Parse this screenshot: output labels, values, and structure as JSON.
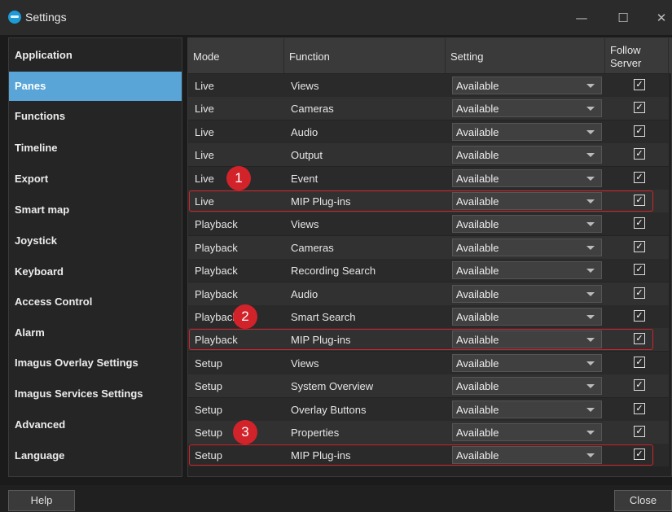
{
  "window": {
    "title": "Settings",
    "minimize_glyph": "—",
    "maximize_glyph": "☐",
    "close_glyph": "✕"
  },
  "sidebar": {
    "items": [
      {
        "label": "Application"
      },
      {
        "label": "Panes",
        "selected": true
      },
      {
        "label": "Functions"
      },
      {
        "label": "Timeline"
      },
      {
        "label": "Export"
      },
      {
        "label": "Smart map"
      },
      {
        "label": "Joystick"
      },
      {
        "label": "Keyboard"
      },
      {
        "label": "Access Control"
      },
      {
        "label": "Alarm"
      },
      {
        "label": "Imagus Overlay Settings"
      },
      {
        "label": "Imagus Services Settings"
      },
      {
        "label": "Advanced"
      },
      {
        "label": "Language"
      }
    ]
  },
  "table": {
    "headers": {
      "mode": "Mode",
      "function": "Function",
      "setting": "Setting",
      "follow_line1": "Follow",
      "follow_line2": "Server"
    },
    "rows": [
      {
        "mode": "Live",
        "function": "Views",
        "setting": "Available",
        "follow": true
      },
      {
        "mode": "Live",
        "function": "Cameras",
        "setting": "Available",
        "follow": true
      },
      {
        "mode": "Live",
        "function": "Audio",
        "setting": "Available",
        "follow": true
      },
      {
        "mode": "Live",
        "function": "Output",
        "setting": "Available",
        "follow": true
      },
      {
        "mode": "Live",
        "function": "Event",
        "setting": "Available",
        "follow": true
      },
      {
        "mode": "Live",
        "function": "MIP Plug-ins",
        "setting": "Available",
        "follow": true
      },
      {
        "mode": "Playback",
        "function": "Views",
        "setting": "Available",
        "follow": true
      },
      {
        "mode": "Playback",
        "function": "Cameras",
        "setting": "Available",
        "follow": true
      },
      {
        "mode": "Playback",
        "function": "Recording Search",
        "setting": "Available",
        "follow": true
      },
      {
        "mode": "Playback",
        "function": "Audio",
        "setting": "Available",
        "follow": true
      },
      {
        "mode": "Playback",
        "function": "Smart Search",
        "setting": "Available",
        "follow": true
      },
      {
        "mode": "Playback",
        "function": "MIP Plug-ins",
        "setting": "Available",
        "follow": true
      },
      {
        "mode": "Setup",
        "function": "Views",
        "setting": "Available",
        "follow": true
      },
      {
        "mode": "Setup",
        "function": "System Overview",
        "setting": "Available",
        "follow": true
      },
      {
        "mode": "Setup",
        "function": "Overlay Buttons",
        "setting": "Available",
        "follow": true
      },
      {
        "mode": "Setup",
        "function": "Properties",
        "setting": "Available",
        "follow": true
      },
      {
        "mode": "Setup",
        "function": "MIP Plug-ins",
        "setting": "Available",
        "follow": true
      }
    ]
  },
  "annotations": [
    {
      "number": "1",
      "highlighted_row": 5
    },
    {
      "number": "2",
      "highlighted_row": 11
    },
    {
      "number": "3",
      "highlighted_row": 16
    }
  ],
  "check_glyph": "✓",
  "footer": {
    "help_label": "Help",
    "close_label": "Close"
  },
  "colors": {
    "accent": "#5aa5d8",
    "highlight": "#d2232a",
    "app_icon": "#1e9ad6"
  }
}
